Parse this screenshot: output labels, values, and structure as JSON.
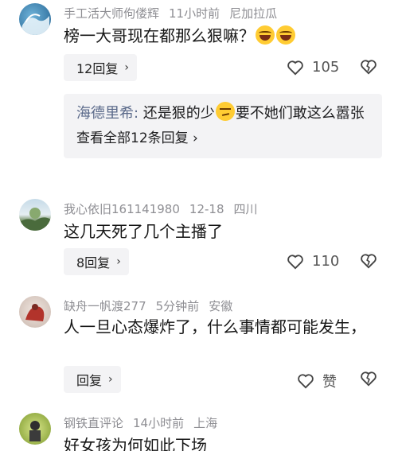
{
  "comments": [
    {
      "username": "手工活大师佝偻辉",
      "time": "11小时前",
      "location": "尼加拉瓜",
      "text": "榜一大哥现在都那么狠嘛？",
      "emoji": [
        "laughing-tears",
        "laughing-tears"
      ],
      "reply_button": "12回复",
      "likes": "105",
      "sub_reply": {
        "author": "海德里希:",
        "text_before": " 还是狠的少",
        "emoji": "smirk",
        "text_after": "要不她们敢这么嚣张",
        "view_all": "查看全部12条回复"
      }
    },
    {
      "username": "我心依旧161141980",
      "time": "12-18",
      "location": "四川",
      "text": "这几天死了几个主播了",
      "reply_button": "8回复",
      "likes": "110"
    },
    {
      "username": "缺舟一帆渡277",
      "time": "5分钟前",
      "location": "安徽",
      "text": "人一旦心态爆炸了，什么事情都可能发生，",
      "reply_button": "回复",
      "likes": "赞"
    },
    {
      "username": "钢铁直评论",
      "time": "14小时前",
      "location": "上海",
      "text": "好女孩为何如此下场"
    }
  ],
  "icons": {
    "chevron": "›",
    "like": "heart-icon",
    "dislike": "broken-heart-icon"
  }
}
